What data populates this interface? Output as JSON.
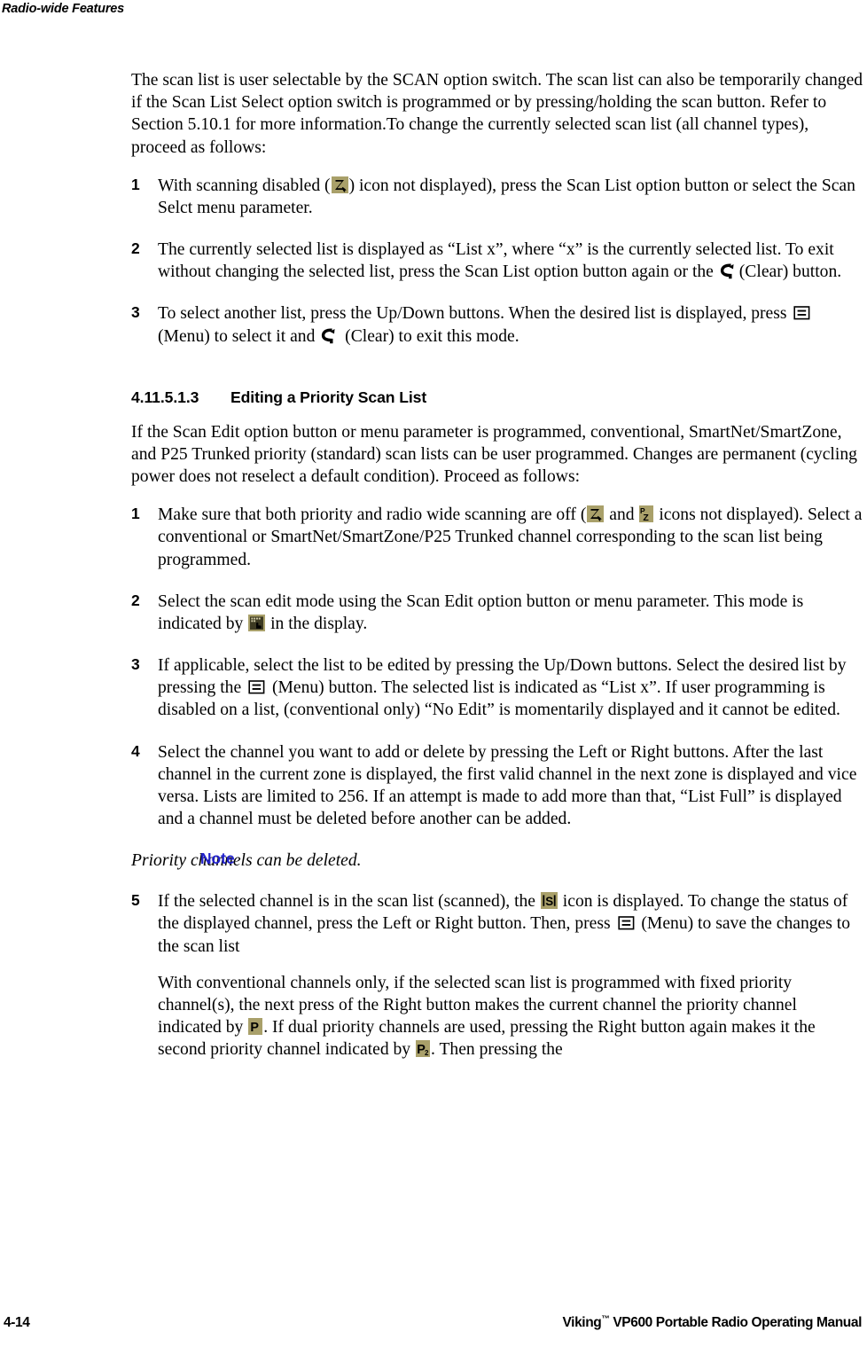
{
  "running_head": "Radio-wide Features",
  "intro_paragraph": "The scan list is user selectable by the SCAN option switch. The scan list can also be temporarily changed if the Scan List Select option switch is programmed or by pressing/holding the scan button. Refer to Section 5.10.1 for more information.To change the currently selected scan list (all channel types), proceed as follows:",
  "first_steps": {
    "step1": {
      "num": "1",
      "text_before": "With scanning disabled (",
      "icon": "scan-z-icon",
      "text_after": ") icon not displayed), press the Scan List option button or select the Scan Selct menu parameter."
    },
    "step2": {
      "num": "2",
      "text_before": "The currently selected list is displayed as “List x”, where “x” is the currently selected list. To exit without changing the selected list, press the Scan List option button again or the ",
      "icon": "clear-back-arrow-icon",
      "text_after": "(Clear) button."
    },
    "step3": {
      "num": "3",
      "text_a": "To select another list, press the Up/Down buttons. When the desired list is displayed, press ",
      "icon_menu": "menu-key-icon",
      "text_b": " (Menu) to select it and ",
      "icon_clear": "clear-back-arrow-icon",
      "text_c": " (Clear) to exit this mode."
    }
  },
  "section": {
    "number": "4.11.5.1.3",
    "title": "Editing a Priority Scan List",
    "intro": "If the Scan Edit option button or menu parameter is programmed, conventional, SmartNet/SmartZone, and P25 Trunked priority (standard) scan lists can be user programmed. Changes are permanent (cycling power does not reselect a default condition). Proceed as follows:"
  },
  "edit_steps": {
    "step1": {
      "num": "1",
      "text_a": "Make sure that both priority and radio wide scanning are off (",
      "icon_scan": "scan-z-icon",
      "text_b": " and ",
      "icon_priority_scan": "priority-scan-pz-icon",
      "text_c": " icons not displayed). Select a conventional or SmartNet/SmartZone/P25 Trunked channel corresponding to the scan list being programmed."
    },
    "step2": {
      "num": "2",
      "text_a": "Select the scan edit mode using the Scan Edit option button or menu parameter. This mode is indicated by ",
      "icon": "scan-edit-keypad-icon",
      "text_b": " in the display."
    },
    "step3": {
      "num": "3",
      "text_a": "If applicable, select the list to be edited by pressing the Up/Down buttons. Select the desired list by pressing the ",
      "icon": "menu-key-icon",
      "text_b": " (Menu) button. The selected list is indicated as “List x”. If user programming is disabled on a list, (conventional only) “No Edit” is momentarily displayed and it cannot be edited."
    },
    "step4": {
      "num": "4",
      "text": "Select the channel you want to add or delete by pressing the Left or Right buttons. After the last channel in the current zone is displayed, the first valid channel in the next zone is displayed and vice versa. Lists are limited to 256. If an attempt is made to add more than that, “List Full” is displayed and a channel must be deleted before another can be added."
    },
    "step5": {
      "num": "5",
      "text_a": "If the selected channel is in the scan list (scanned), the ",
      "icon_scanned": "scanned-s-icon",
      "text_b": " icon is displayed. To change the status of the displayed channel, press the Left or Right button. Then, press ",
      "icon_menu": "menu-key-icon",
      "text_c": " (Menu) to save the changes to the scan list"
    }
  },
  "note": {
    "label": "Note",
    "text": "Priority channels can be deleted."
  },
  "closing_paragraph": {
    "text_a": "With conventional channels only, if the selected scan list is programmed with fixed priority channel(s), the next press of the Right button makes the current channel the priority channel indicated by ",
    "icon_p1": "priority-p-icon",
    "text_b": ". If dual priority channels are used, pressing the Right button again makes it the second priority channel indicated by ",
    "icon_p2": "priority-p2-icon",
    "text_c": ". Then pressing the"
  },
  "footer": {
    "page_number": "4-14",
    "manual_title": "Viking",
    "manual_tm": "™",
    "manual_rest": " VP600 Portable Radio Operating Manual"
  },
  "colors": {
    "icon_background": "#a9a06a",
    "note_label": "#2222cc",
    "text": "#000000",
    "page_background": "#ffffff"
  }
}
